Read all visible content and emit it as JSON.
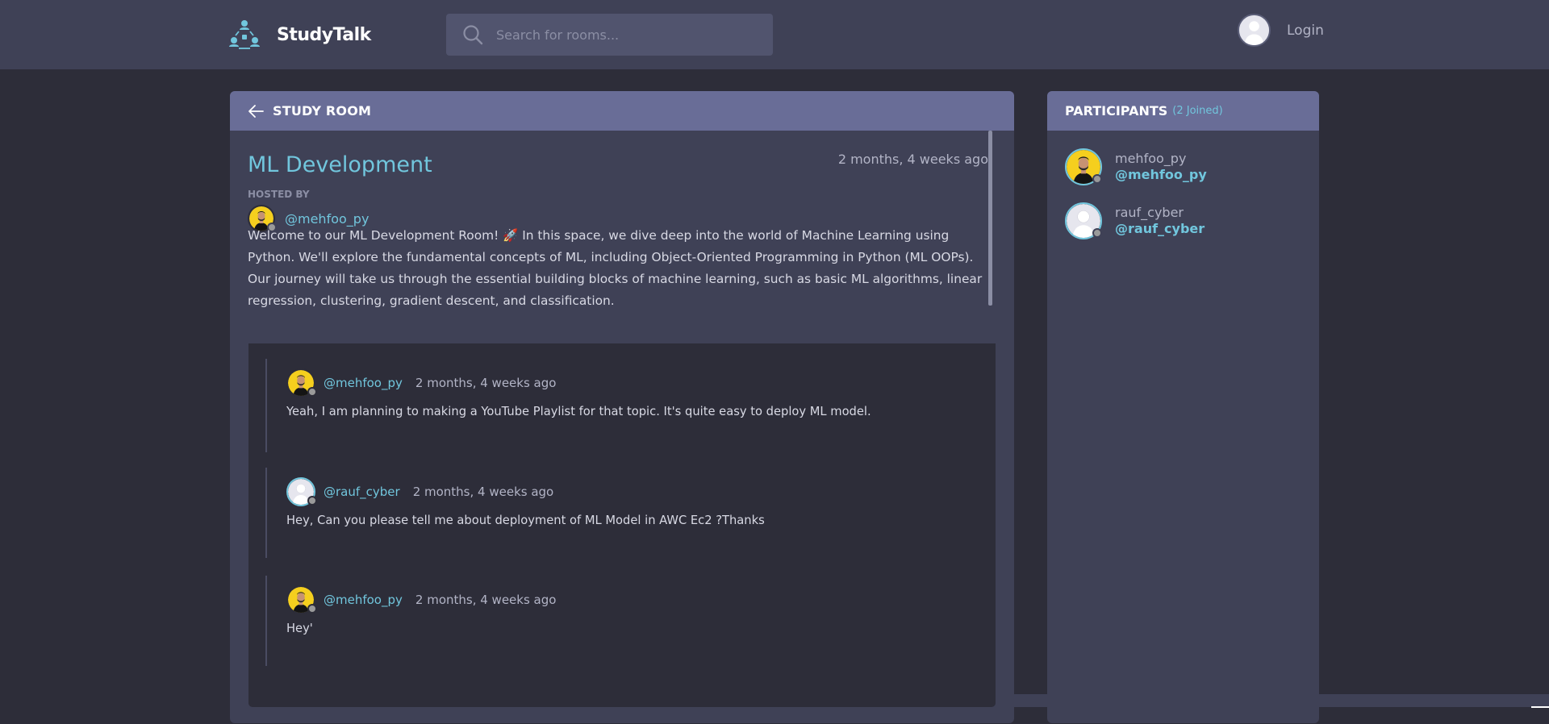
{
  "brand": {
    "name": "StudyTalk",
    "logo_icon": "people-network-icon",
    "accent_color": "#71c6dd"
  },
  "search": {
    "placeholder": "Search for rooms...",
    "icon": "search-icon"
  },
  "account": {
    "login_label": "Login",
    "avatar_icon": "user-silhouette-icon"
  },
  "room": {
    "header_label": "STUDY ROOM",
    "back_icon": "arrow-left-icon",
    "title": "ML Development",
    "created": "2 months, 4 weeks ago",
    "hosted_by_label": "HOSTED BY",
    "host": "@mehfoo_py",
    "description": "Welcome to our ML Development Room! 🚀 In this space, we dive deep into the world of Machine Learning using Python. We'll explore the fundamental concepts of ML, including Object-Oriented Programming in Python (ML OOPs). Our journey will take us through the essential building blocks of machine learning, such as basic ML algorithms, linear regression, clustering, gradient descent, and classification."
  },
  "messages": [
    {
      "user": "@mehfoo_py",
      "time": "2 months, 4 weeks ago",
      "text": "Yeah, I am planning to making a YouTube Playlist for that topic. It's quite easy to deploy ML model.",
      "avatar": "photo-avatar"
    },
    {
      "user": "@rauf_cyber",
      "time": "2 months, 4 weeks ago",
      "text": "Hey, Can you please tell me about deployment of ML Model in AWC Ec2 ?Thanks",
      "avatar": "default-avatar"
    },
    {
      "user": "@mehfoo_py",
      "time": "2 months, 4 weeks ago",
      "text": "Hey'",
      "avatar": "photo-avatar"
    }
  ],
  "participants": {
    "title": "PARTICIPANTS",
    "count_label": "(2 Joined)",
    "list": [
      {
        "name": "mehfoo_py",
        "handle": "@mehfoo_py",
        "avatar": "photo-avatar"
      },
      {
        "name": "rauf_cyber",
        "handle": "@rauf_cyber",
        "avatar": "default-avatar"
      }
    ]
  }
}
